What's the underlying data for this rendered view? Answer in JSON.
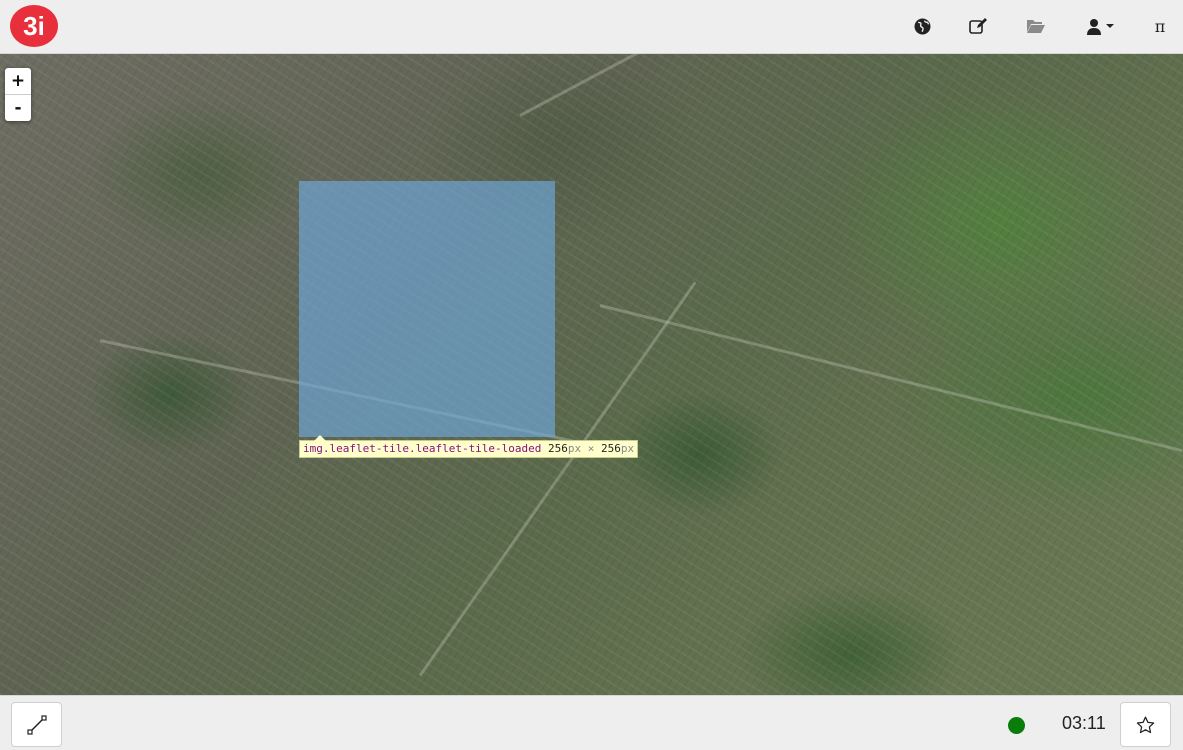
{
  "header": {
    "logo_text": "3i",
    "brand_color": "#e8303c",
    "icons": [
      "globe-icon",
      "edit-icon",
      "folder-open-icon",
      "user-icon",
      "caret-down-icon"
    ],
    "pi_label": "π"
  },
  "map": {
    "zoom_in_label": "+",
    "zoom_out_label": "-",
    "tile_highlight_color": "#6fa8dc",
    "inspector_tooltip": {
      "selector": "img.leaflet-tile.leaflet-tile-loaded",
      "width": "256",
      "height": "256",
      "unit": "px",
      "separator": "×"
    }
  },
  "footer": {
    "measure_icon": "measure-line-icon",
    "status_color": "#0a7c0a",
    "clock": "03:11",
    "favorite_icon": "star-icon"
  }
}
